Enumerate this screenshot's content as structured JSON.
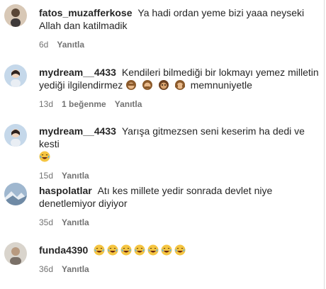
{
  "comments": [
    {
      "username": "fatos_muzafferkose",
      "text": "Ya hadi ordan yeme bizi yaaa neyseki Allah dan katilmadik",
      "emojis": [],
      "time": "6d",
      "likes": "",
      "reply": "Yanıtla"
    },
    {
      "username": "mydream__4433",
      "text": "Kendileri bilmediği bir lokmayı yemez milletin yediği ilgilendirmez",
      "emojis": [
        "monkey-face",
        "monkey-face",
        "monkey-face",
        "monkey-face"
      ],
      "text_after": "memnuniyetle",
      "time": "13d",
      "likes": "1 beğenme",
      "reply": "Yanıtla"
    },
    {
      "username": "mydream__4433",
      "text": "Yarışa gitmezsen seni keserim ha dedi ve kesti",
      "emojis": [
        "laughing-face"
      ],
      "time": "15d",
      "likes": "",
      "reply": "Yanıtla"
    },
    {
      "username": "haspolatlar",
      "text": "Atı kes millete yedir sonrada devlet niye denetlemiyor diyiyor",
      "emojis": [],
      "time": "35d",
      "likes": "",
      "reply": "Yanıtla"
    },
    {
      "username": "funda4390",
      "text": "",
      "emojis": [
        "laughing-face",
        "laughing-face",
        "laughing-face",
        "laughing-face",
        "laughing-face",
        "laughing-face",
        "laughing-face"
      ],
      "time": "36d",
      "likes": "",
      "reply": "Yanıtla"
    }
  ],
  "colors": {
    "text": "#262626",
    "meta": "#737373",
    "border": "#dbdbdb"
  }
}
